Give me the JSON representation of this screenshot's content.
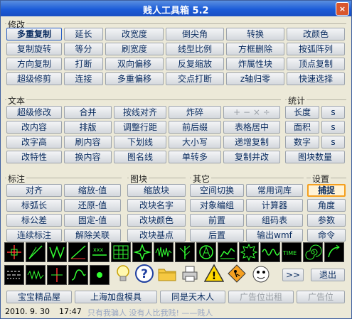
{
  "window": {
    "title": "贱人工具箱 5.2",
    "close_label": "×"
  },
  "groups": {
    "modify": "修改",
    "text": "文本",
    "stats": "统计",
    "annot": "标注",
    "block": "图块",
    "other": "其它",
    "setting": "设置"
  },
  "modify_rows": [
    [
      "多重复制",
      "延长",
      "改宽度",
      "倒尖角",
      "转换",
      "改颜色"
    ],
    [
      "复制旋转",
      "等分",
      "刷宽度",
      "线型比例",
      "方框删除",
      "按弧阵列"
    ],
    [
      "方向复制",
      "打断",
      "双向偏移",
      "反复缩放",
      "炸属性块",
      "顶点复制"
    ],
    [
      "超级修剪",
      "连接",
      "多重偏移",
      "交点打断",
      "z轴归零",
      "快速选择"
    ]
  ],
  "text_rows": [
    [
      "超级修改",
      "合并",
      "按线对齐",
      "炸碎",
      "+ − × ÷"
    ],
    [
      "改内容",
      "排版",
      "调整行距",
      "前后缀",
      "表格居中"
    ],
    [
      "改字高",
      "刷内容",
      "下划线",
      "大小写",
      "递增复制"
    ],
    [
      "改特性",
      "换内容",
      "图名线",
      "单转多",
      "复制并改"
    ]
  ],
  "stats_rows": [
    [
      "长度",
      "s"
    ],
    [
      "面积",
      "s"
    ],
    [
      "数字",
      "s"
    ],
    [
      "图块数量"
    ]
  ],
  "annot_rows": [
    [
      "对齐",
      "缩放-值"
    ],
    [
      "标弧长",
      "还原-值"
    ],
    [
      "标公差",
      "固定-值"
    ],
    [
      "连续标注",
      "解除关联"
    ]
  ],
  "block_rows": [
    "缩放块",
    "改块名字",
    "改块颜色",
    "改块基点"
  ],
  "other_rows": [
    [
      "空间切换",
      "常用词库"
    ],
    [
      "对象编组",
      "计算器"
    ],
    [
      "前置",
      "组码表"
    ],
    [
      "后置",
      "输出wmf"
    ]
  ],
  "setting_rows": [
    "捕捉",
    "角度",
    "参数",
    "命令"
  ],
  "icons_row1": [
    "crosshair-icon",
    "diagonal-line-icon",
    "zigzag-icon",
    "slope-line-icon",
    "xxx-line-icon",
    "grid-table-icon",
    "star-icon",
    "squiggle-icon",
    "branch-icon",
    "circle-a-icon",
    "xxx-wave-icon",
    "gear-outline-icon",
    "wave-icon",
    "time-text-icon",
    "spiral-icon",
    "curve-arrow-icon"
  ],
  "icon_time_text": "TIME",
  "icon_xxx_text": "xxx",
  "icons_row2": [
    "dashed-lines-icon",
    "spring-icon",
    "vertical-line-icon",
    "s-curve-icon",
    "dot-icon",
    "lightbulb-icon",
    "help-icon",
    "folder-icon",
    "printer-icon",
    "warning-icon",
    "construction-icon",
    "mascot-icon"
  ],
  "forward_label": ">>",
  "exit_label": "退出",
  "bottom_buttons": [
    "宝宝精品屋",
    "上海加盘模具",
    "同是天木人",
    "广告位出租",
    "广告位"
  ],
  "status": {
    "date": "2010. 9. 30",
    "time": "17:47",
    "motto": "只有我骗人 没有人比我贱! ——贱人"
  }
}
